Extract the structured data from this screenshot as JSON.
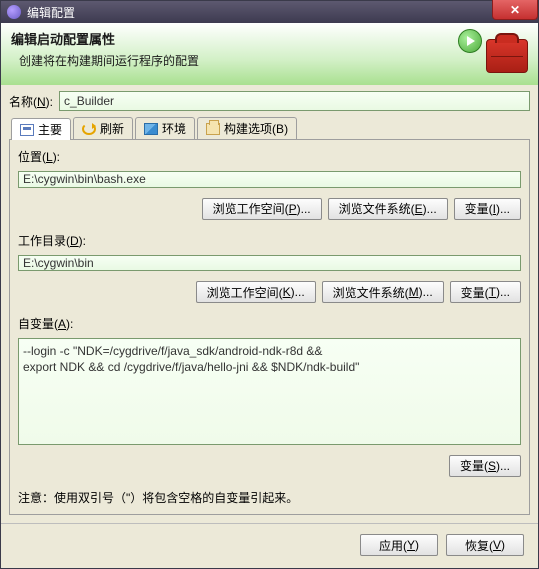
{
  "window": {
    "title": "编辑配置"
  },
  "banner": {
    "heading": "编辑启动配置属性",
    "sub": "创建将在构建期间运行程序的配置"
  },
  "nameRow": {
    "label_pre": "名称(",
    "label_u": "N",
    "label_post": "):",
    "value": "c_Builder"
  },
  "tabs": {
    "main": {
      "label_before": "主要",
      "icon": "main-icon"
    },
    "refresh": {
      "label_before": "刷新",
      "icon": "refresh-icon"
    },
    "env": {
      "label_before": "环境",
      "icon": "env-icon"
    },
    "build": {
      "label_before": "构建选项(",
      "u": "B",
      "label_after": ")",
      "icon": "build-icon"
    }
  },
  "location": {
    "label_pre": "位置(",
    "label_u": "L",
    "label_post": "):",
    "value": "E:\\cygwin\\bin\\bash.exe",
    "btnWs_pre": "浏览工作空间(",
    "btnWs_u": "P",
    "btnWs_post": ")...",
    "btnFs_pre": "浏览文件系统(",
    "btnFs_u": "E",
    "btnFs_post": ")...",
    "btnVar_pre": "变量(",
    "btnVar_u": "I",
    "btnVar_post": ")..."
  },
  "workdir": {
    "label_pre": "工作目录(",
    "label_u": "D",
    "label_post": "):",
    "value": "E:\\cygwin\\bin",
    "btnWs_pre": "浏览工作空间(",
    "btnWs_u": "K",
    "btnWs_post": ")...",
    "btnFs_pre": "浏览文件系统(",
    "btnFs_u": "M",
    "btnFs_post": ")...",
    "btnVar_pre": "变量(",
    "btnVar_u": "T",
    "btnVar_post": ")..."
  },
  "args": {
    "label_pre": "自变量(",
    "label_u": "A",
    "label_post": "):",
    "value": "--login -c \"NDK=/cygdrive/f/java_sdk/android-ndk-r8d &&\nexport NDK && cd /cygdrive/f/java/hello-jni && $NDK/ndk-build\"",
    "btnVar_pre": "变量(",
    "btnVar_u": "S",
    "btnVar_post": ")..."
  },
  "note": "注意：使用双引号（\"）将包含空格的自变量引起来。",
  "footer": {
    "apply_pre": "应用(",
    "apply_u": "Y",
    "apply_post": ")",
    "revert_pre": "恢复(",
    "revert_u": "V",
    "revert_post": ")"
  }
}
